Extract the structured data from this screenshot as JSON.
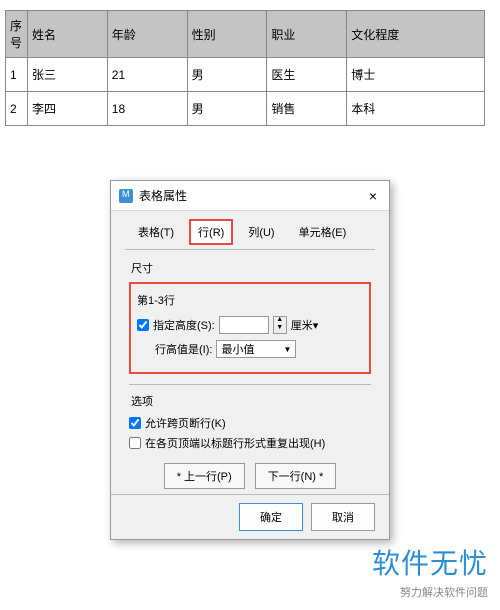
{
  "table": {
    "headers": [
      "序号",
      "姓名",
      "年龄",
      "性别",
      "职业",
      "文化程度"
    ],
    "rows": [
      [
        "1",
        "张三",
        "21",
        "男",
        "医生",
        "博士"
      ],
      [
        "2",
        "李四",
        "18",
        "男",
        "销售",
        "本科"
      ]
    ]
  },
  "dialog": {
    "title": "表格属性",
    "close": "×",
    "tabs": {
      "table": "表格(T)",
      "row": "行(R)",
      "column": "列(U)",
      "cell": "单元格(E)"
    },
    "size": {
      "group_label": "尺寸",
      "row_range": "第1-3行",
      "specify_height_label": "指定高度(S):",
      "height_value": "",
      "unit": "厘米",
      "row_height_is_label": "行高值是(I):",
      "row_height_mode": "最小值"
    },
    "options": {
      "group_label": "选项",
      "allow_break": "允许跨页断行(K)",
      "repeat_header": "在各页顶端以标题行形式重复出现(H)"
    },
    "nav": {
      "prev": "* 上一行(P)",
      "next": "下一行(N) *"
    },
    "footer": {
      "ok": "确定",
      "cancel": "取消"
    }
  },
  "watermark": {
    "main": "软件无忧",
    "sub": "努力解决软件问题"
  }
}
